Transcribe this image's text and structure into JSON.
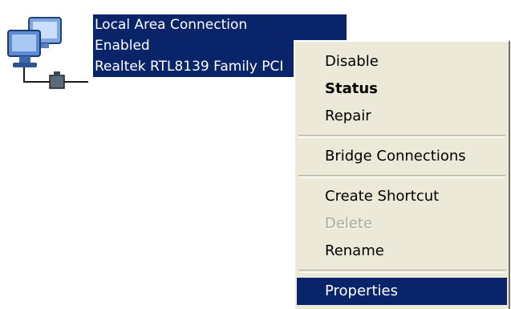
{
  "connection": {
    "name": "Local Area Connection",
    "status": "Enabled",
    "device": "Realtek RTL8139 Family PCI"
  },
  "menu": {
    "disable": "Disable",
    "status": "Status",
    "repair": "Repair",
    "bridge": "Bridge Connections",
    "create_shortcut": "Create Shortcut",
    "delete": "Delete",
    "rename": "Rename",
    "properties": "Properties"
  },
  "colors": {
    "selection": "#0a246a",
    "menu_background": "#ece9d8",
    "disabled_text": "#aca899"
  }
}
